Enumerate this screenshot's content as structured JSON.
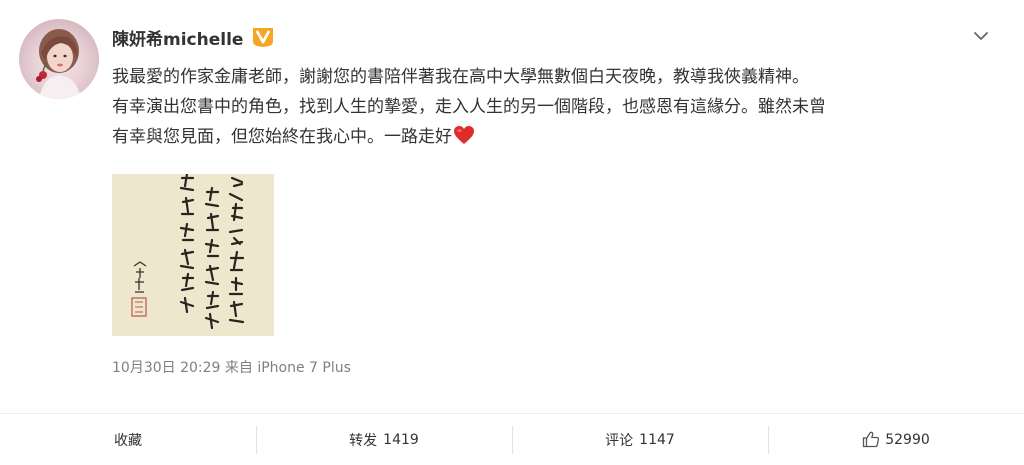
{
  "post": {
    "user_name": "陳妍希michelle",
    "badge_icon": "verified-v-badge-icon",
    "avatar": "user-avatar",
    "text_lines": [
      "我最愛的作家金庸老師，謝謝您的書陪伴著我在高中大學無數個白天夜晚，教導我俠義精神。",
      "有幸演出您書中的角色，找到人生的摯愛，走入人生的另一個階段，也感恩有這緣分。雖然未曾",
      "有幸與您見面，但您始終在我心中。一路走好"
    ],
    "heart_icon": "red-heart-emoji-icon",
    "image": "calligraphy-photo",
    "meta": "10月30日 20:29 来自 iPhone 7 Plus"
  },
  "actions": {
    "favorite": {
      "label": "收藏"
    },
    "repost": {
      "label": "转发",
      "count": "1419"
    },
    "comment": {
      "label": "评论",
      "count": "1147"
    },
    "like": {
      "count": "52990",
      "icon": "thumbs-up-icon"
    }
  },
  "colors": {
    "text": "#333333",
    "meta": "#808080",
    "badge": "#f5a623",
    "heart": "#e02b2b",
    "divider": "#ececec"
  }
}
